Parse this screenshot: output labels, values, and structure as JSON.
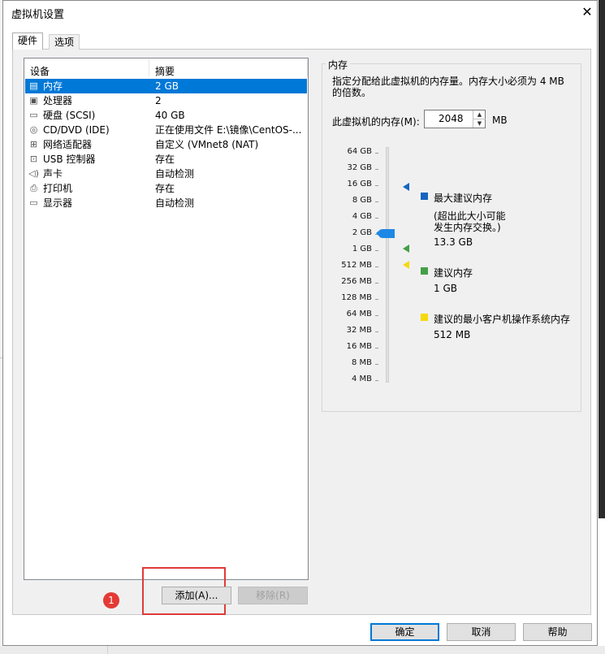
{
  "dialog": {
    "title": "虚拟机设置",
    "close_glyph": "✕"
  },
  "tabs": [
    "硬件",
    "选项"
  ],
  "device_list": {
    "header_device": "设备",
    "header_summary": "摘要",
    "rows": [
      {
        "icon": "memory-icon",
        "name": "内存",
        "summary": "2 GB",
        "selected": true
      },
      {
        "icon": "processor-icon",
        "name": "处理器",
        "summary": "2"
      },
      {
        "icon": "hard-disk-icon",
        "name": "硬盘 (SCSI)",
        "summary": "40 GB"
      },
      {
        "icon": "cd-dvd-icon",
        "name": "CD/DVD (IDE)",
        "summary": "正在使用文件 E:\\镜像\\CentOS-..."
      },
      {
        "icon": "network-adapter-icon",
        "name": "网络适配器",
        "summary": "自定义 (VMnet8 (NAT)"
      },
      {
        "icon": "usb-controller-icon",
        "name": "USB 控制器",
        "summary": "存在"
      },
      {
        "icon": "sound-card-icon",
        "name": "声卡",
        "summary": "自动检测"
      },
      {
        "icon": "printer-icon",
        "name": "打印机",
        "summary": "存在"
      },
      {
        "icon": "display-icon",
        "name": "显示器",
        "summary": "自动检测"
      }
    ],
    "add_button": "添加(A)...",
    "remove_button": "移除(R)",
    "annotation_number": "1"
  },
  "memory": {
    "group_title": "内存",
    "description": "指定分配给此虚拟机的内存量。内存大小必须为 4 MB 的倍数。",
    "label": "此虚拟机的内存(M):",
    "value": "2048",
    "unit": "MB",
    "scale": [
      "64 GB",
      "32 GB",
      "16 GB",
      "8 GB",
      "4 GB",
      "2 GB",
      "1 GB",
      "512 MB",
      "256 MB",
      "128 MB",
      "64 MB",
      "32 MB",
      "16 MB",
      "8 MB",
      "4 MB"
    ],
    "slider_value": "2 GB",
    "legend": {
      "max_title": "最大建议内存",
      "max_note_1": "(超出此大小可能",
      "max_note_2": "发生内存交换。)",
      "max_value": "13.3 GB",
      "rec_title": "建议内存",
      "rec_value": "1 GB",
      "min_title": "建议的最小客户机操作系统内存",
      "min_value": "512 MB"
    },
    "colors": {
      "max": "#1565c0",
      "recommended": "#43a047",
      "minimum": "#f5d90a",
      "thumb": "#1e88e5"
    }
  },
  "footer": {
    "ok": "确定",
    "cancel": "取消",
    "help": "帮助"
  }
}
